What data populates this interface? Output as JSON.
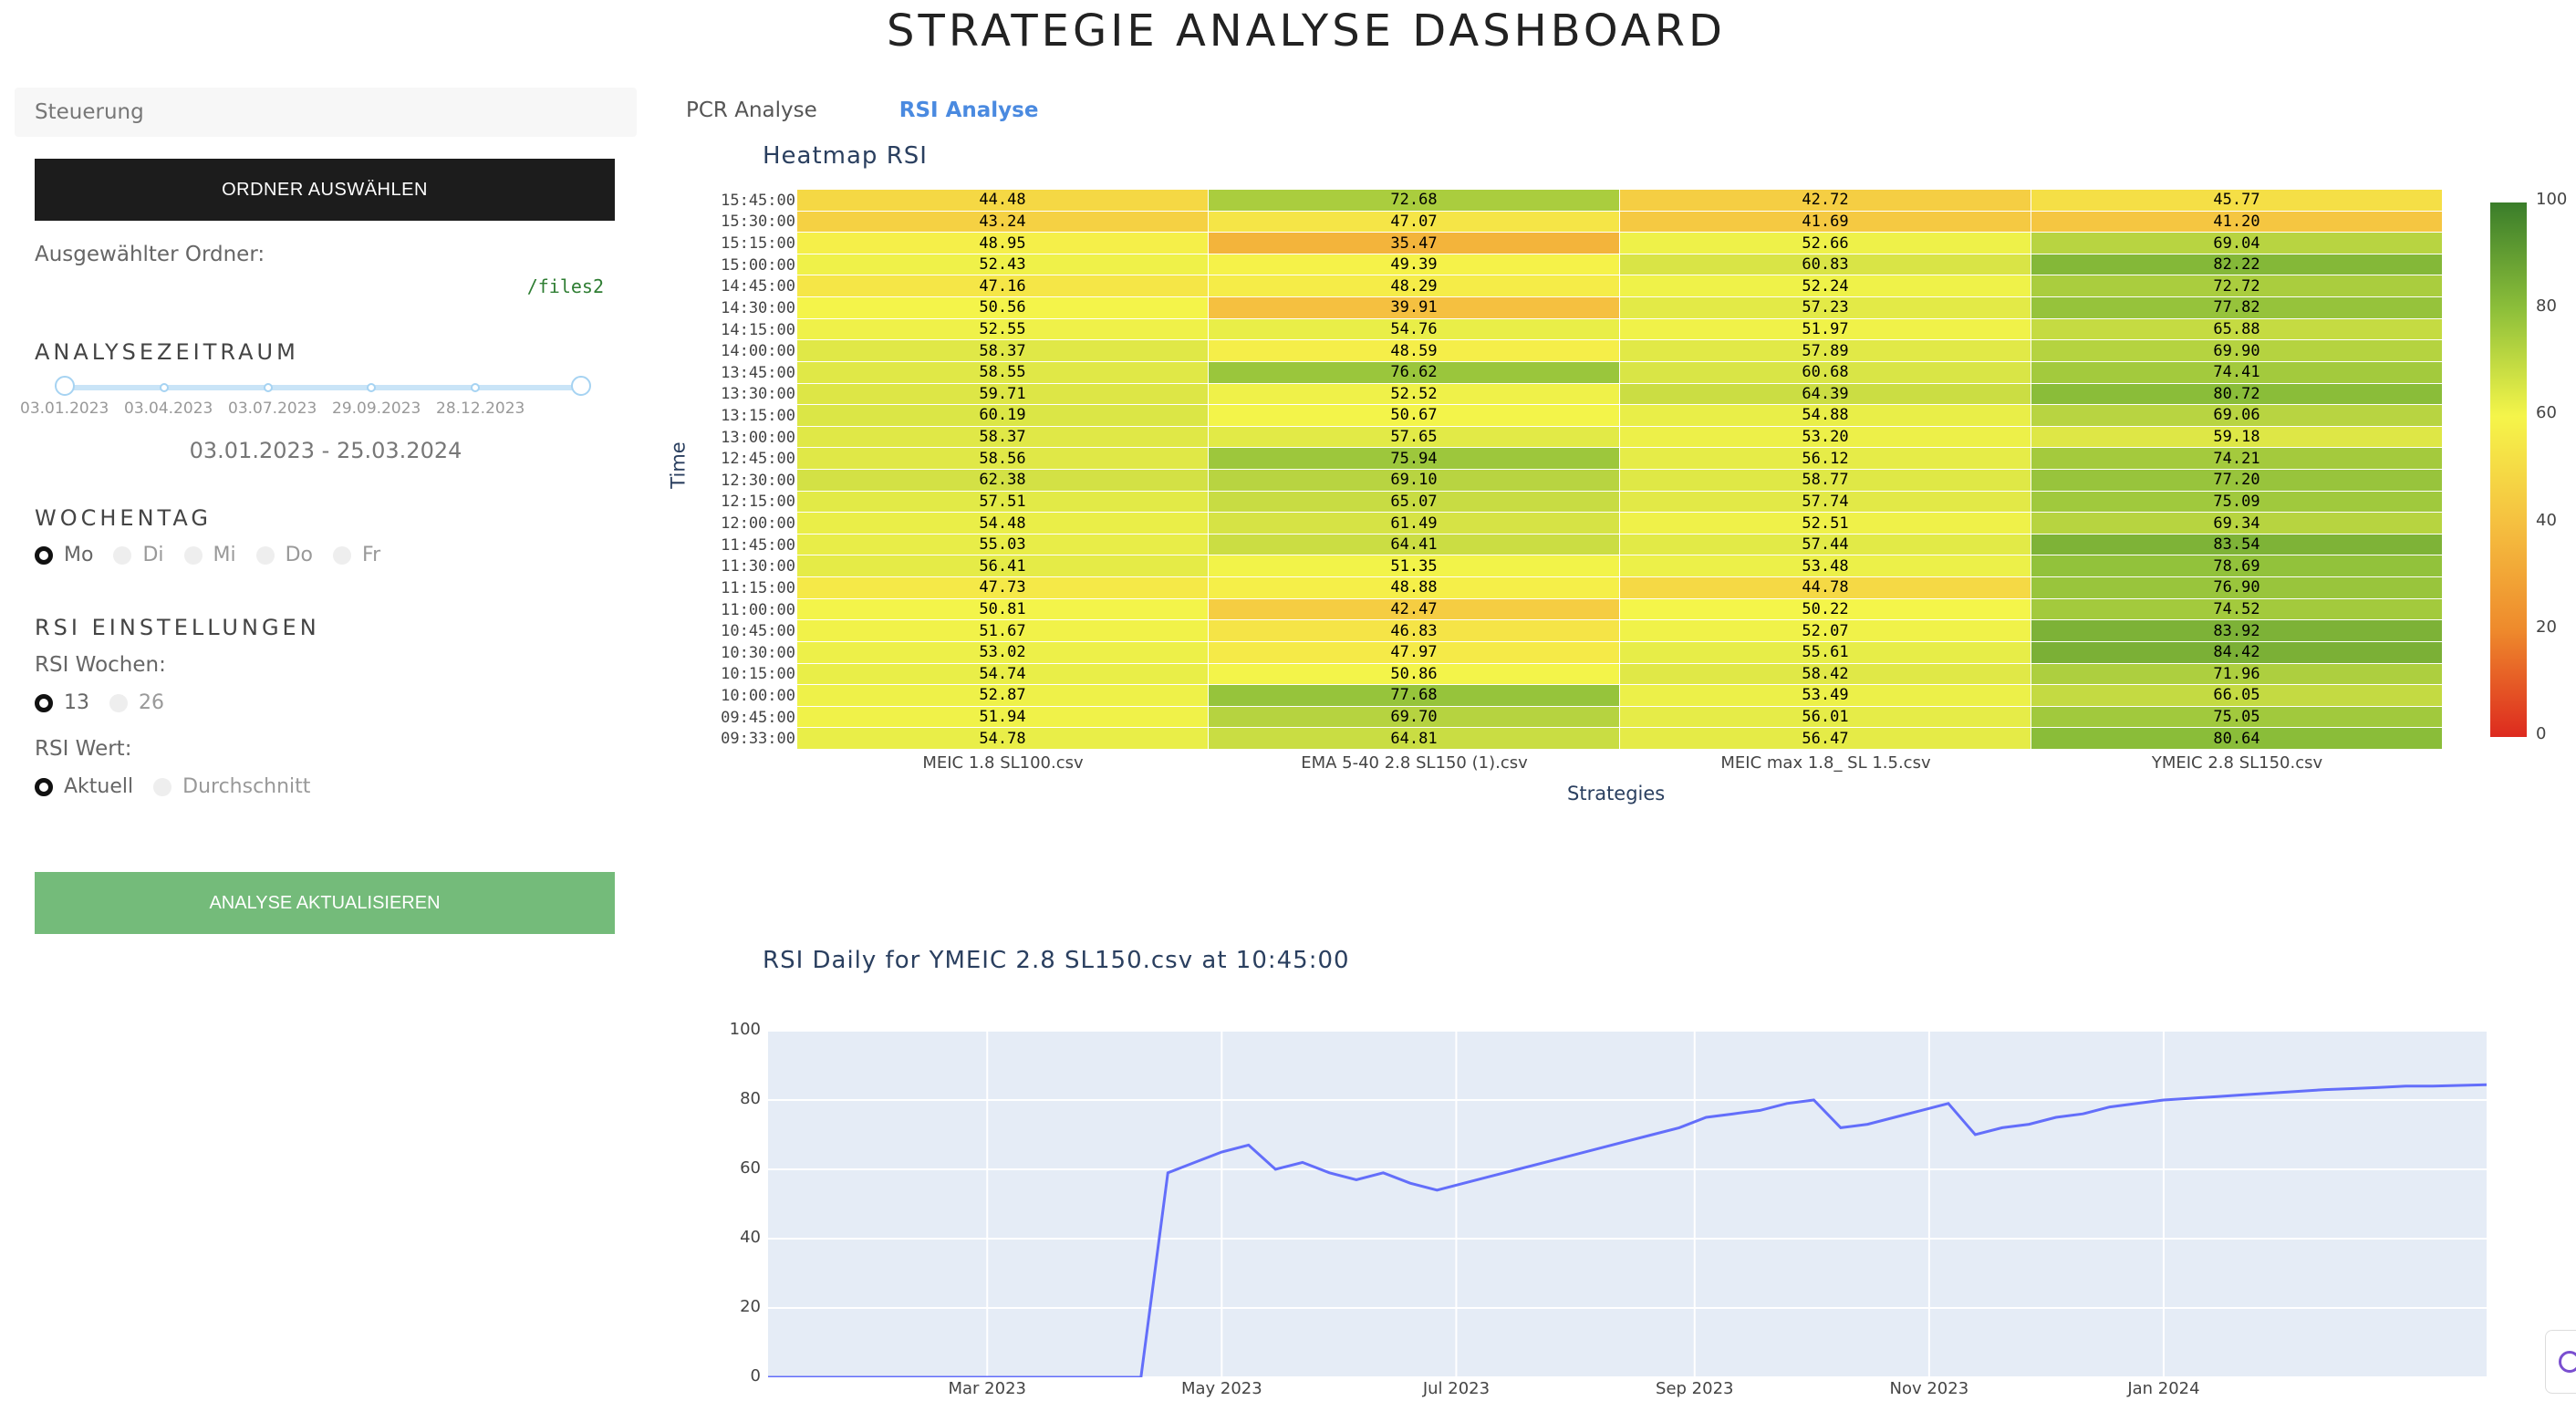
{
  "page": {
    "title": "STRATEGIE ANALYSE DASHBOARD"
  },
  "sidebar": {
    "header": "Steuerung",
    "select_folder_button": "ORDNER AUSWÄHLEN",
    "selected_folder_label": "Ausgewählter Ordner:",
    "selected_folder_path": "/files2",
    "period_title": "ANALYSEZEITRAUM",
    "slider_ticks": [
      "03.01.2023",
      "03.04.2023",
      "03.07.2023",
      "29.09.2023",
      "28.12.2023"
    ],
    "date_range": "03.01.2023 - 25.03.2024",
    "weekday_title": "WOCHENTAG",
    "weekdays": [
      {
        "label": "Mo",
        "selected": true
      },
      {
        "label": "Di",
        "selected": false
      },
      {
        "label": "Mi",
        "selected": false
      },
      {
        "label": "Do",
        "selected": false
      },
      {
        "label": "Fr",
        "selected": false
      }
    ],
    "rsi_title": "RSI EINSTELLUNGEN",
    "rsi_weeks_label": "RSI Wochen:",
    "rsi_weeks": [
      {
        "label": "13",
        "selected": true
      },
      {
        "label": "26",
        "selected": false
      }
    ],
    "rsi_value_label": "RSI Wert:",
    "rsi_values": [
      {
        "label": "Aktuell",
        "selected": true
      },
      {
        "label": "Durchschnitt",
        "selected": false
      }
    ],
    "update_button": "ANALYSE AKTUALISIEREN"
  },
  "tabs": [
    {
      "label": "PCR Analyse",
      "active": false
    },
    {
      "label": "RSI Analyse",
      "active": true
    }
  ],
  "colors": {
    "accent": "#4a8ae0",
    "dark_button": "#1c1c1c",
    "green_button": "#74bb7a",
    "line": "#636efa"
  },
  "chart_data": [
    {
      "type": "heatmap",
      "title": "Heatmap RSI",
      "xlabel": "Strategies",
      "ylabel": "Time",
      "categories": [
        "MEIC 1.8 SL100.csv",
        "EMA 5-40 2.8 SL150 (1).csv",
        "MEIC max 1.8_ SL 1.5.csv",
        "YMEIC 2.8 SL150.csv"
      ],
      "y": [
        "15:45:00",
        "15:30:00",
        "15:15:00",
        "15:00:00",
        "14:45:00",
        "14:30:00",
        "14:15:00",
        "14:00:00",
        "13:45:00",
        "13:30:00",
        "13:15:00",
        "13:00:00",
        "12:45:00",
        "12:30:00",
        "12:15:00",
        "12:00:00",
        "11:45:00",
        "11:30:00",
        "11:15:00",
        "11:00:00",
        "10:45:00",
        "10:30:00",
        "10:15:00",
        "10:00:00",
        "09:45:00",
        "09:33:00"
      ],
      "values": [
        [
          "44.48",
          "72.68",
          "42.72",
          "45.77"
        ],
        [
          "43.24",
          "47.07",
          "41.69",
          "41.20"
        ],
        [
          "48.95",
          "35.47",
          "52.66",
          "69.04"
        ],
        [
          "52.43",
          "49.39",
          "60.83",
          "82.22"
        ],
        [
          "47.16",
          "48.29",
          "52.24",
          "72.72"
        ],
        [
          "50.56",
          "39.91",
          "57.23",
          "77.82"
        ],
        [
          "52.55",
          "54.76",
          "51.97",
          "65.88"
        ],
        [
          "58.37",
          "48.59",
          "57.89",
          "69.90"
        ],
        [
          "58.55",
          "76.62",
          "60.68",
          "74.41"
        ],
        [
          "59.71",
          "52.52",
          "64.39",
          "80.72"
        ],
        [
          "60.19",
          "50.67",
          "54.88",
          "69.06"
        ],
        [
          "58.37",
          "57.65",
          "53.20",
          "59.18"
        ],
        [
          "58.56",
          "75.94",
          "56.12",
          "74.21"
        ],
        [
          "62.38",
          "69.10",
          "58.77",
          "77.20"
        ],
        [
          "57.51",
          "65.07",
          "57.74",
          "75.09"
        ],
        [
          "54.48",
          "61.49",
          "52.51",
          "69.34"
        ],
        [
          "55.03",
          "64.41",
          "57.44",
          "83.54"
        ],
        [
          "56.41",
          "51.35",
          "53.48",
          "78.69"
        ],
        [
          "47.73",
          "48.88",
          "44.78",
          "76.90"
        ],
        [
          "50.81",
          "42.47",
          "50.22",
          "74.52"
        ],
        [
          "51.67",
          "46.83",
          "52.07",
          "83.92"
        ],
        [
          "53.02",
          "47.97",
          "55.61",
          "84.42"
        ],
        [
          "54.74",
          "50.86",
          "58.42",
          "71.96"
        ],
        [
          "52.87",
          "77.68",
          "53.49",
          "66.05"
        ],
        [
          "51.94",
          "69.70",
          "56.01",
          "75.05"
        ],
        [
          "54.78",
          "64.81",
          "56.47",
          "80.64"
        ]
      ],
      "colorbar": {
        "min": 0,
        "max": 100,
        "ticks": [
          "100",
          "80",
          "60",
          "40",
          "20",
          "0"
        ]
      }
    },
    {
      "type": "line",
      "title": "RSI Daily for YMEIC 2.8 SL150.csv at 10:45:00",
      "ylim": [
        0,
        100
      ],
      "yticks": [
        "100",
        "80",
        "60",
        "40",
        "20",
        "0"
      ],
      "xticks": [
        "Mar 2023",
        "May 2023",
        "Jul 2023",
        "Sep 2023",
        "Nov 2023",
        "Jan 2024"
      ],
      "x_range": [
        "2023-01-03",
        "2024-03-25"
      ],
      "x": [
        "2023-01-03",
        "2023-04-10",
        "2023-04-17",
        "2023-04-24",
        "2023-05-01",
        "2023-05-08",
        "2023-05-15",
        "2023-05-22",
        "2023-05-29",
        "2023-06-05",
        "2023-06-12",
        "2023-06-19",
        "2023-06-26",
        "2023-07-03",
        "2023-07-10",
        "2023-07-17",
        "2023-07-24",
        "2023-07-31",
        "2023-08-07",
        "2023-08-14",
        "2023-08-21",
        "2023-08-28",
        "2023-09-04",
        "2023-09-11",
        "2023-09-18",
        "2023-09-25",
        "2023-10-02",
        "2023-10-09",
        "2023-10-16",
        "2023-10-23",
        "2023-10-30",
        "2023-11-06",
        "2023-11-13",
        "2023-11-20",
        "2023-11-27",
        "2023-12-04",
        "2023-12-11",
        "2023-12-18",
        "2023-12-25",
        "2024-01-01",
        "2024-01-08",
        "2024-01-15",
        "2024-01-22",
        "2024-01-29",
        "2024-02-05",
        "2024-02-12",
        "2024-02-19",
        "2024-02-26",
        "2024-03-04",
        "2024-03-11",
        "2024-03-18",
        "2024-03-25"
      ],
      "y": [
        0,
        0,
        59,
        62,
        65,
        67,
        60,
        62,
        59,
        57,
        59,
        56,
        54,
        56,
        58,
        60,
        62,
        64,
        66,
        68,
        70,
        72,
        75,
        76,
        77,
        79,
        80,
        72,
        73,
        75,
        77,
        79,
        70,
        72,
        73,
        75,
        76,
        78,
        79,
        80,
        80.5,
        81,
        81.5,
        82,
        82.5,
        83,
        83.3,
        83.6,
        84,
        84,
        84.2,
        84.4
      ]
    }
  ]
}
